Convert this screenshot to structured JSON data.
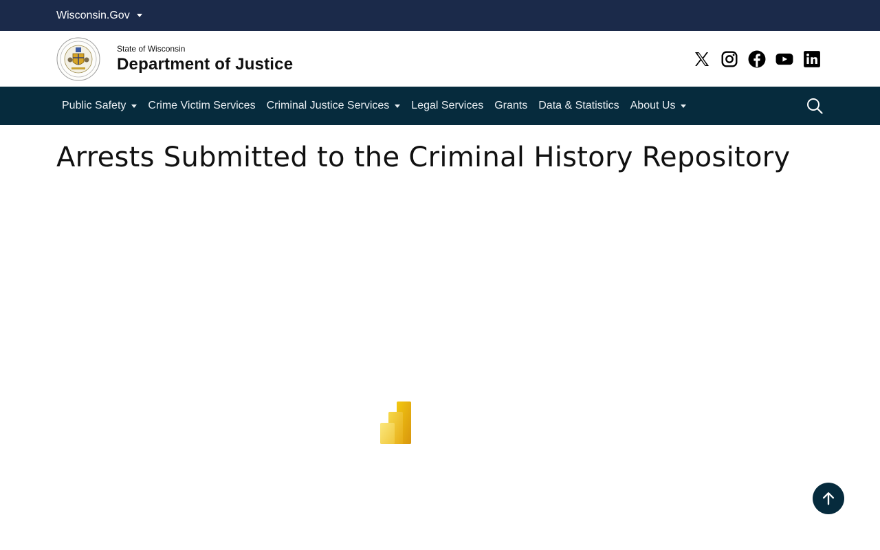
{
  "topbar": {
    "label": "Wisconsin.Gov"
  },
  "header": {
    "state_label": "State of Wisconsin",
    "department_label": "Department of Justice",
    "seal_icon": "wisconsin-doj-seal-icon"
  },
  "social": {
    "icons": [
      "x-icon",
      "instagram-icon",
      "facebook-icon",
      "youtube-icon",
      "linkedin-icon"
    ]
  },
  "nav": {
    "items": [
      {
        "label": "Public Safety",
        "dropdown": true
      },
      {
        "label": "Crime Victim Services",
        "dropdown": false
      },
      {
        "label": "Criminal Justice Services",
        "dropdown": true
      },
      {
        "label": "Legal Services",
        "dropdown": false
      },
      {
        "label": "Grants",
        "dropdown": false
      },
      {
        "label": "Data & Statistics",
        "dropdown": false
      },
      {
        "label": "About Us",
        "dropdown": true
      }
    ],
    "search_icon": "search-icon"
  },
  "main": {
    "title": "Arrests Submitted to the Criminal History Repository",
    "report_loading_icon": "power-bi-logo-icon"
  },
  "colors": {
    "topbar": "#1b2a4a",
    "navbar": "#062b3d",
    "back_to_top": "#062b3d",
    "pbi_gold": "#e8b314"
  },
  "back_to_top_icon": "arrow-up-icon"
}
